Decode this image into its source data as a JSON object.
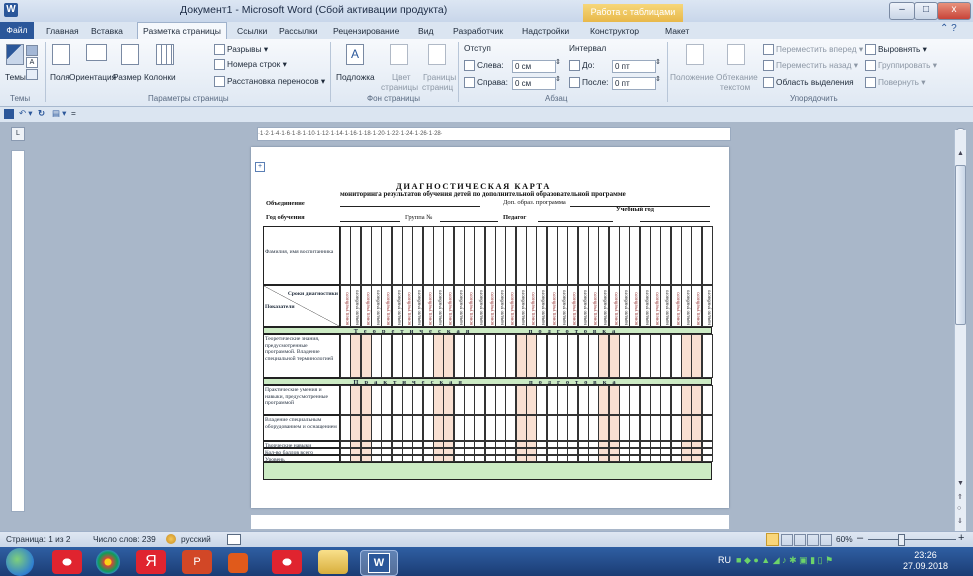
{
  "window": {
    "title": "Документ1 - Microsoft Word (Сбой активации продукта)",
    "context_tab": "Работа с таблицами",
    "minimize": "–",
    "maximize": "□",
    "close": "x"
  },
  "tabs": [
    "Файл",
    "Главная",
    "Вставка",
    "Разметка страницы",
    "Ссылки",
    "Рассылки",
    "Рецензирование",
    "Вид",
    "Разработчик",
    "Надстройки",
    "Конструктор",
    "Макет"
  ],
  "ribbon": {
    "themes": {
      "button": "Темы",
      "group": "Темы"
    },
    "page_setup": {
      "fields": "Поля",
      "orientation": "Ориентация",
      "size": "Размер",
      "columns": "Колонки",
      "breaks": "Разрывы",
      "line_numbers": "Номера строк",
      "hyphenation": "Расстановка переносов",
      "group": "Параметры страницы"
    },
    "page_background": {
      "watermark": "Подложка",
      "color_l1": "Цвет",
      "color_l2": "страницы",
      "borders_l1": "Границы",
      "borders_l2": "страниц",
      "group": "Фон страницы"
    },
    "paragraph": {
      "indent": "Отступ",
      "left_label": "Слева:",
      "left_value": "0 см",
      "right_label": "Справа:",
      "right_value": "0 см",
      "spacing": "Интервал",
      "before_label": "До:",
      "before_value": "0 пт",
      "after_label": "После:",
      "after_value": "0 пт",
      "group": "Абзац"
    },
    "arrange": {
      "position": "Положение",
      "wrap_l1": "Обтекание",
      "wrap_l2": "текстом",
      "bring_forward": "Переместить вперед",
      "send_backward": "Переместить назад",
      "selection_pane": "Область выделения",
      "align": "Выровнять",
      "group_btn": "Группировать",
      "rotate": "Повернуть",
      "group": "Упорядочить"
    }
  },
  "qat": {
    "customize": "="
  },
  "ruler": {
    "corner": "L",
    "marks": "·1·2·1·4·1·6·1·8·1·10·1·12·1·14·1·16·1·18·1·20·1·22·1·24·1·26·1·28·"
  },
  "document": {
    "heading": "ДИАГНОСТИЧЕСКАЯ  КАРТА",
    "subheading": "мониторинга результатов обучения детей по дополнительной образовательной программе",
    "label_association": "Объединение",
    "label_program": "Доп. образ. программа",
    "label_year": "Год обучения",
    "label_group": "Группа №",
    "label_teacher": "Педагог",
    "label_academic_year": "Учебный год",
    "hdr_name": "Фамилия, имя воспитанника",
    "hdr_terms": "Сроки диагностики",
    "hdr_indicators": "Показатели",
    "col_start": "начало учебного",
    "col_end": "конец учебного",
    "section_theory": "Теоретическая       подготовка",
    "section_practice": "Практическая        подготовка",
    "row_theory": "Теоретические знания, предусмотренные программой. Владение специальной терминологией",
    "row_practice": "Практические умения и навыки, предусмотренные программой",
    "row_equipment": "Владение специальным оборудованием и оснащением",
    "row_creative": "Творческие навыки",
    "row_total": "Кол-во баллов всего",
    "row_level": "Уровень"
  },
  "status": {
    "page": "Страница: 1 из 2",
    "words": "Число слов: 239",
    "language": "русский",
    "zoom": "60%",
    "zoom_minus": "–",
    "zoom_plus": "+"
  },
  "taskbar": {
    "lang": "RU",
    "time": "23:26",
    "date": "27.09.2018"
  },
  "colors": {
    "section_band": "#ccebc4",
    "shaded_col": "#f9e0d2",
    "ribbon_accent": "#2b579a"
  }
}
